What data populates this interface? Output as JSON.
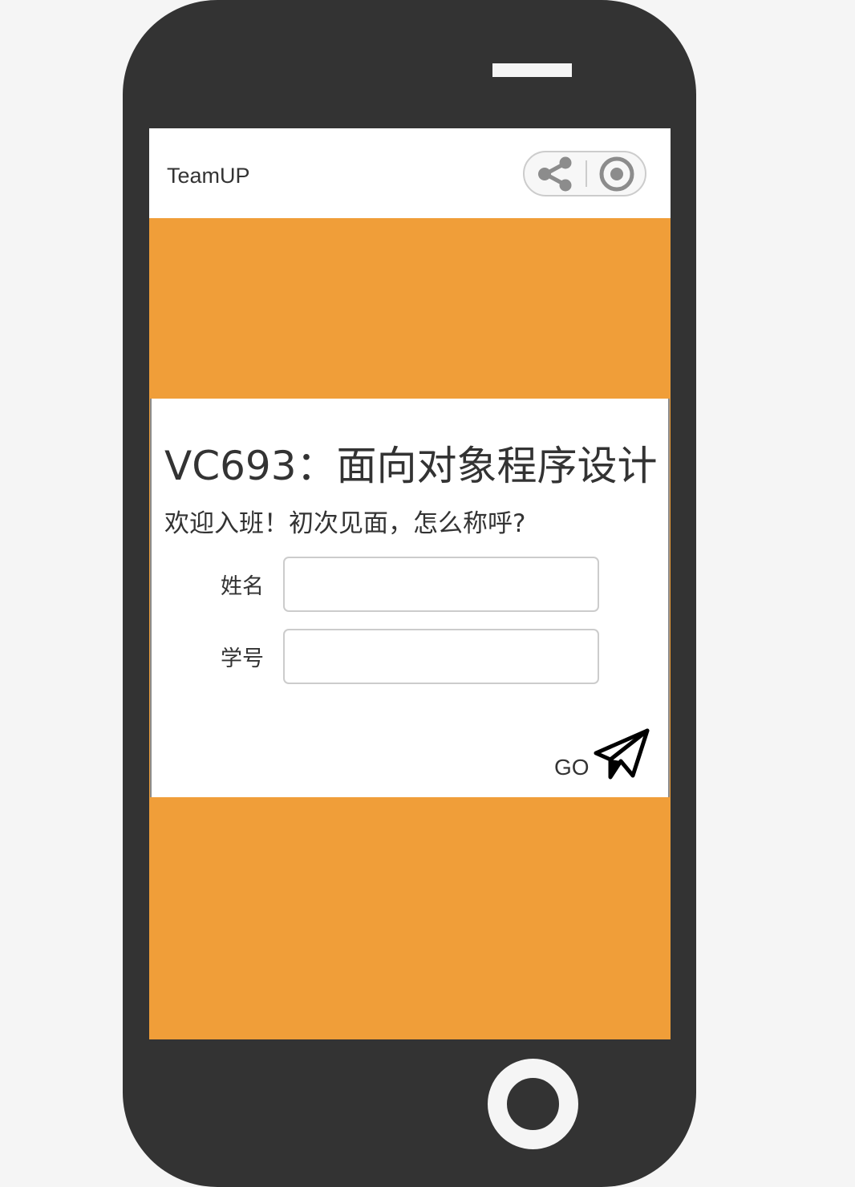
{
  "app": {
    "title": "TeamUP"
  },
  "capsule": {
    "share_icon": "share-icon",
    "record_icon": "record-icon"
  },
  "course": {
    "title": "VC693：面向对象程序设计",
    "welcome": "欢迎入班！初次见面，怎么称呼?"
  },
  "form": {
    "name_label": "姓名",
    "name_value": "",
    "name_placeholder": "",
    "student_id_label": "学号",
    "student_id_value": "",
    "student_id_placeholder": ""
  },
  "action": {
    "go_label": "GO",
    "go_icon": "paper-plane-icon"
  },
  "colors": {
    "accent": "#f09e39",
    "phone_body": "#333333",
    "background": "#f5f5f5",
    "text": "#333333"
  }
}
